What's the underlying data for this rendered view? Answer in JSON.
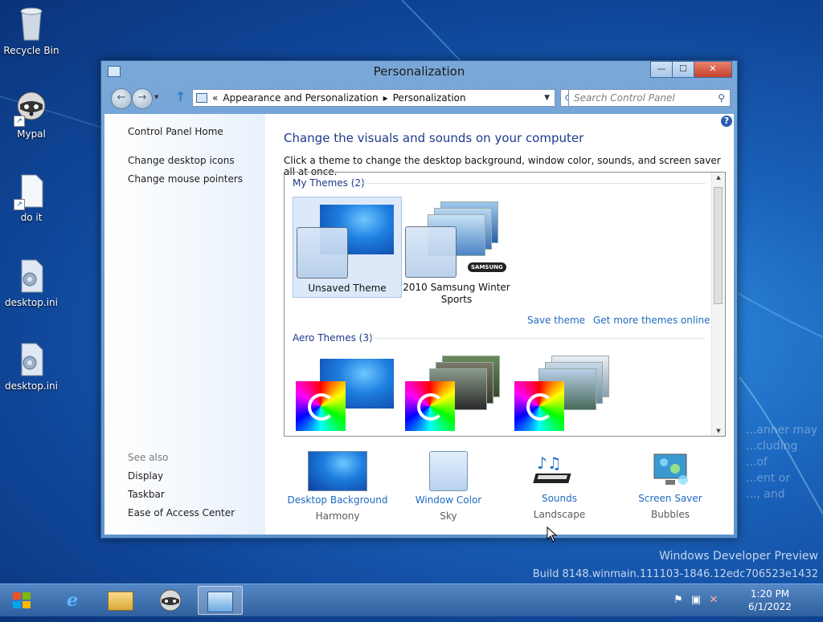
{
  "desktop": {
    "icons": [
      {
        "label": "Recycle Bin",
        "icon": "recycle-bin-icon"
      },
      {
        "label": "Mypal",
        "icon": "mypal-raccoon-icon"
      },
      {
        "label": "do it",
        "icon": "document-icon"
      },
      {
        "label": "desktop.ini",
        "icon": "settings-file-icon"
      },
      {
        "label": "desktop.ini",
        "icon": "settings-file-icon"
      }
    ],
    "watermark": {
      "line1": "Windows Developer Preview",
      "line2": "Build 8148.winmain.111103-1846.12edc706523e1432",
      "faint": [
        "...anner may",
        "...cluding",
        "...of",
        "...ent or",
        "..., and"
      ]
    }
  },
  "window": {
    "title": "Personalization",
    "controls": {
      "minimize": "—",
      "maximize": "☐",
      "close": "✕"
    },
    "nav": {
      "back": "←",
      "forward": "→",
      "up": "↑",
      "address": [
        "«",
        "Appearance and Personalization",
        "▸",
        "Personalization"
      ],
      "address_dropdown": "▼",
      "refresh": "⟳",
      "search_placeholder": "Search Control Panel",
      "search_icon": "⚲"
    },
    "left_pane": {
      "home": "Control Panel Home",
      "links": [
        "Change desktop icons",
        "Change mouse pointers"
      ],
      "see_also_label": "See also",
      "see_also": [
        "Display",
        "Taskbar",
        "Ease of Access Center"
      ]
    },
    "main": {
      "heading": "Change the visuals and sounds on your computer",
      "description": "Click a theme to change the desktop background, window color, sounds, and screen saver all at once.",
      "help": "?",
      "my_themes": {
        "label": "My Themes (2)",
        "items": [
          {
            "name": "Unsaved Theme",
            "selected": true
          },
          {
            "name": "2010 Samsung Winter Sports",
            "badge": "SAMSUNG",
            "selected": false
          }
        ]
      },
      "actions": {
        "save": "Save theme",
        "more": "Get more themes online"
      },
      "aero_themes": {
        "label": "Aero Themes (3)"
      },
      "bottom": [
        {
          "name": "Desktop Background",
          "value": "Harmony",
          "icon": "desktop-background-icon"
        },
        {
          "name": "Window Color",
          "value": "Sky",
          "icon": "window-color-icon"
        },
        {
          "name": "Sounds",
          "value": "Landscape",
          "icon": "sounds-icon"
        },
        {
          "name": "Screen Saver",
          "value": "Bubbles",
          "icon": "screen-saver-icon"
        }
      ]
    }
  },
  "taskbar": {
    "items": [
      "start-orb-icon",
      "internet-explorer-icon",
      "file-explorer-icon",
      "mypal-raccoon-icon",
      "control-panel-icon"
    ],
    "clock": {
      "time": "1:20 PM",
      "date": "6/1/2022"
    },
    "tray": [
      "action-center-flag-icon",
      "network-icon",
      "volume-muted-icon"
    ]
  }
}
